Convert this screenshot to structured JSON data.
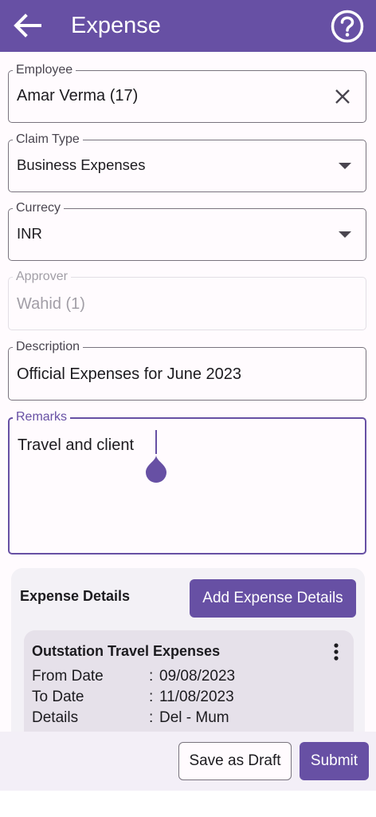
{
  "app_bar": {
    "title": "Expense",
    "back_icon": "arrow-back-icon",
    "help_icon": "help-circle-icon"
  },
  "form": {
    "employee": {
      "label": "Employee",
      "value": "Amar Verma (17)",
      "clear_icon": "close-icon"
    },
    "claim_type": {
      "label": "Claim Type",
      "value": "Business Expenses",
      "dropdown_icon": "dropdown-arrow-icon"
    },
    "currency": {
      "label": "Currecy",
      "value": "INR",
      "dropdown_icon": "dropdown-arrow-icon"
    },
    "approver": {
      "label": "Approver",
      "value": "Wahid (1)",
      "disabled": true
    },
    "description": {
      "label": "Description",
      "value": "Official Expenses for June 2023"
    },
    "remarks": {
      "label": "Remarks",
      "value": "Travel and client",
      "focused": true
    }
  },
  "expense_details": {
    "title": "Expense Details",
    "add_button": "Add Expense Details",
    "items": [
      {
        "title": "Outstation Travel Expenses",
        "menu_icon": "more-vertical-icon",
        "rows": [
          {
            "key": "From Date",
            "sep": ":",
            "value": "09/08/2023"
          },
          {
            "key": "To Date",
            "sep": ":",
            "value": "11/08/2023"
          },
          {
            "key": "Details",
            "sep": ":",
            "value": "Del - Mum"
          }
        ]
      }
    ]
  },
  "actions": {
    "save_draft": "Save as Draft",
    "submit": "Submit"
  },
  "colors": {
    "primary": "#6750a4",
    "surface": "#fffbfe",
    "outline": "#79747e"
  }
}
